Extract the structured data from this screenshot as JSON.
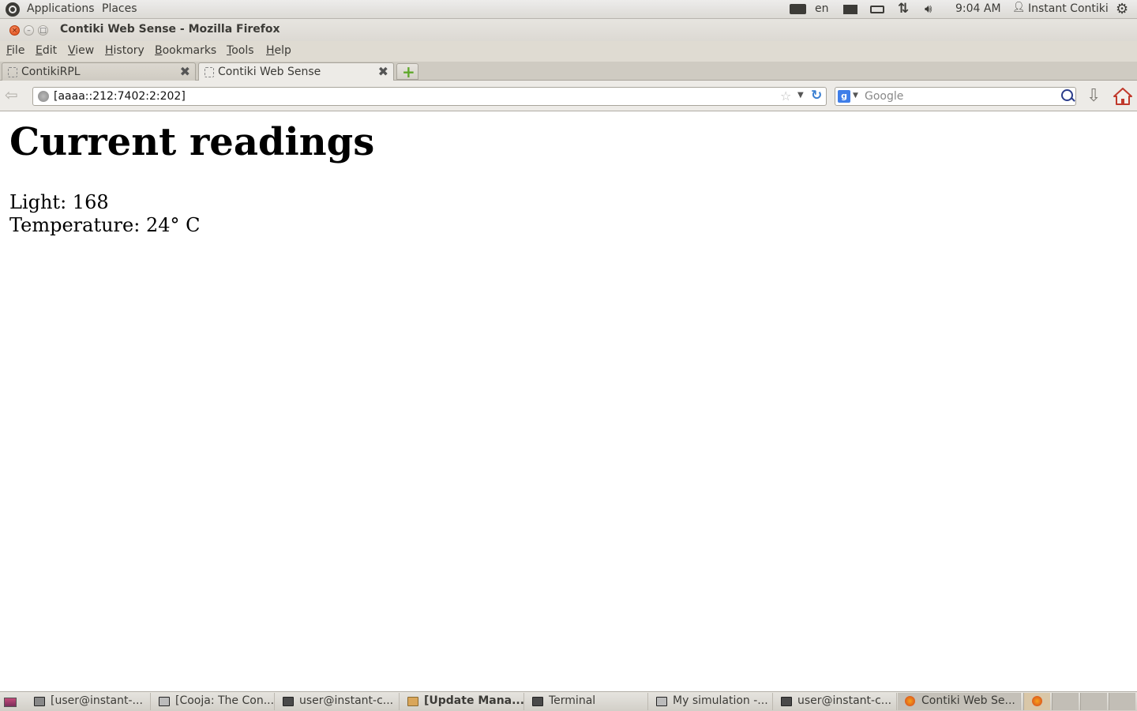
{
  "top_panel": {
    "applications": "Applications",
    "places": "Places",
    "keyboard_layout": "en",
    "clock": "9:04 AM",
    "user": "Instant Contiki"
  },
  "window": {
    "title": "Contiki Web Sense - Mozilla Firefox"
  },
  "menu": {
    "items": [
      "File",
      "Edit",
      "View",
      "History",
      "Bookmarks",
      "Tools",
      "Help"
    ]
  },
  "tabs": [
    {
      "label": "ContikiRPL"
    },
    {
      "label": "Contiki Web Sense"
    }
  ],
  "nav": {
    "url": "[aaaa::212:7402:2:202]",
    "search_placeholder": "Google"
  },
  "content": {
    "heading": "Current readings",
    "light": "Light: 168",
    "temperature": "Temperature: 24° C"
  },
  "taskbar": {
    "tasks": [
      {
        "label": "[user@instant-..."
      },
      {
        "label": "[Cooja: The Con..."
      },
      {
        "label": "user@instant-c..."
      },
      {
        "label": "[Update Mana..."
      },
      {
        "label": "Terminal"
      },
      {
        "label": "My simulation -..."
      },
      {
        "label": "user@instant-c..."
      },
      {
        "label": "Contiki Web Se..."
      }
    ]
  },
  "colors": {
    "accent": "#dd4814",
    "panel_bg": "#dfdbd2",
    "reload_blue": "#3a7fd1",
    "new_tab_green": "#5fa82b"
  }
}
